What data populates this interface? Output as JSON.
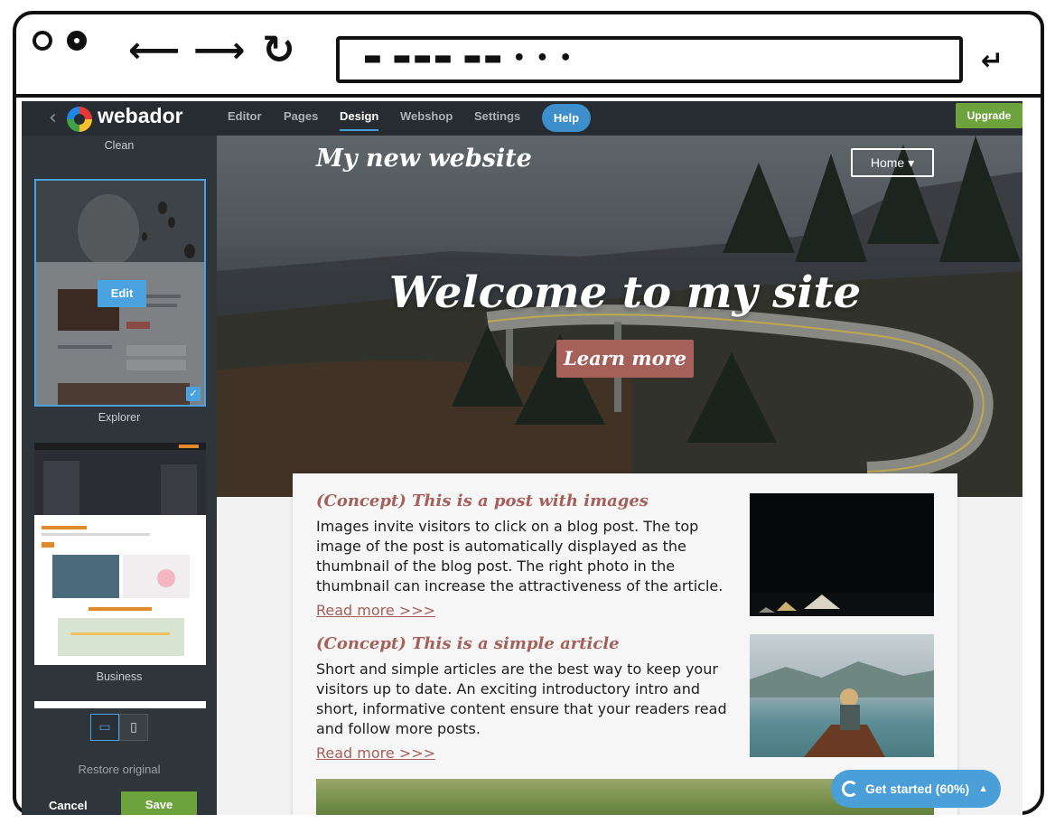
{
  "browser": {
    "url_scribble": "▬ ▬▬▬ ▬▬ • • •"
  },
  "app": {
    "brand": "webador",
    "tabs": [
      "Editor",
      "Pages",
      "Design",
      "Webshop",
      "Settings"
    ],
    "active_tab": "Design",
    "help_label": "Help",
    "upgrade_label": "Upgrade"
  },
  "panel": {
    "templates": [
      {
        "name": "Clean",
        "selected": true,
        "edit_label": "Edit"
      },
      {
        "name": "Explorer"
      },
      {
        "name": "Business"
      }
    ],
    "restore_label": "Restore original",
    "cancel_label": "Cancel",
    "save_label": "Save"
  },
  "site": {
    "title": "My new website",
    "menu_label": "Home",
    "hero_heading": "Welcome to my site",
    "cta_label": "Learn more",
    "posts": [
      {
        "title": "(Concept) This is a post with images",
        "text": "Images invite visitors to click on a blog post. The top image of the post is automatically displayed as the thumbnail of the blog post. The right photo in the thumbnail can increase the attractiveness of the article.",
        "read_more": "Read more >>>"
      },
      {
        "title": "(Concept) This is a simple article",
        "text": "Short and simple articles are the best way to keep your visitors up to date. An exciting introductory intro and short, informative content ensure that your readers read and follow more posts.",
        "read_more": "Read more >>>"
      }
    ]
  },
  "get_started": {
    "label": "Get started (60%)",
    "progress": 60
  },
  "colors": {
    "accent_blue": "#4a9fd8",
    "save_green": "#6ca33c",
    "post_accent": "#a5605a"
  }
}
